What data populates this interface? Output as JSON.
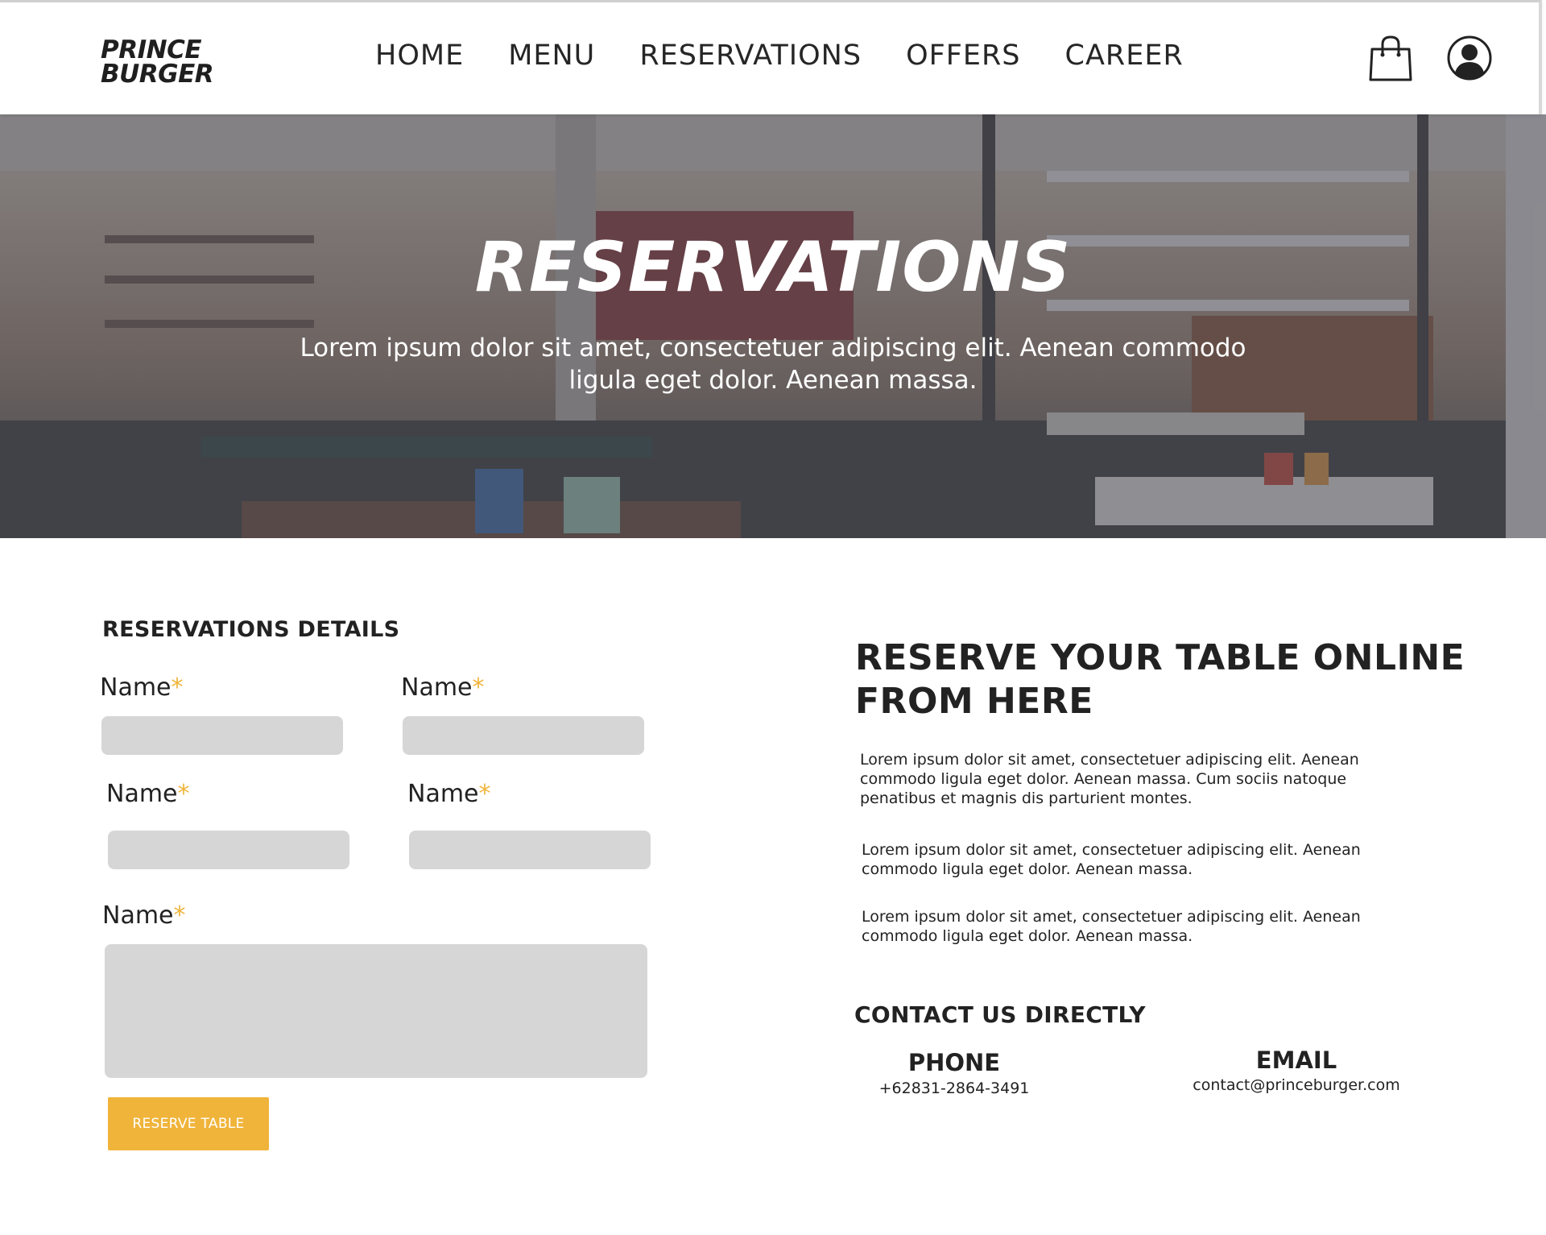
{
  "header": {
    "logo_line1": "PRINCE",
    "logo_line2": "BURGER",
    "nav": [
      "HOME",
      "MENU",
      "RESERVATIONS",
      "OFFERS",
      "CAREER"
    ],
    "icons": [
      "shopping-bag-icon",
      "user-account-icon"
    ]
  },
  "hero": {
    "title": "RESERVATIONS",
    "subtitle": "Lorem ipsum dolor sit amet, consectetuer adipiscing elit. Aenean commodo ligula eget dolor. Aenean massa."
  },
  "form": {
    "title": "RESERVATIONS DETAILS",
    "fields": [
      {
        "label": "Name",
        "required": "*",
        "value": ""
      },
      {
        "label": "Name",
        "required": "*",
        "value": ""
      },
      {
        "label": "Name",
        "required": "*",
        "value": ""
      },
      {
        "label": "Name",
        "required": "*",
        "value": ""
      },
      {
        "label": "Name",
        "required": "*",
        "value": ""
      }
    ],
    "submit_label": "RESERVE TABLE"
  },
  "info": {
    "title": "RESERVE YOUR TABLE ONLINE FROM HERE",
    "paragraphs": [
      "Lorem ipsum dolor sit amet, consectetuer adipiscing elit. Aenean commodo ligula eget dolor. Aenean massa. Cum sociis natoque penatibus et magnis dis parturient montes.",
      "Lorem ipsum dolor sit amet, consectetuer adipiscing elit. Aenean commodo ligula eget dolor. Aenean massa.",
      "Lorem ipsum dolor sit amet, consectetuer adipiscing elit. Aenean commodo ligula eget dolor. Aenean massa."
    ]
  },
  "contact": {
    "title": "CONTACT US DIRECTLY",
    "phone_label": "PHONE",
    "phone_value": "+62831-2864-3491",
    "email_label": "EMAIL",
    "email_value": "contact@princeburger.com"
  },
  "colors": {
    "accent": "#f0b43a",
    "field_bg": "#d6d6d6",
    "text": "#222222"
  }
}
